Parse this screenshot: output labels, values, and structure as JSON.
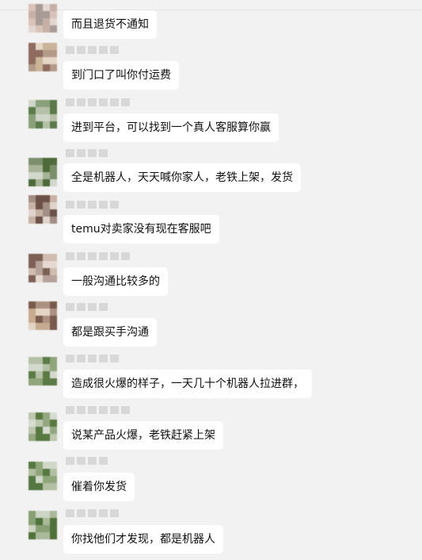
{
  "messages": [
    {
      "text": "而且退货不通知"
    },
    {
      "text": "到门口了叫你付运费"
    },
    {
      "text": "进到平台，可以找到一个真人客服算你赢"
    },
    {
      "text": "全是机器人，天天喊你家人，老铁上架，发货"
    },
    {
      "text": "temu对卖家没有现在客服吧"
    },
    {
      "text": "一般沟通比较多的"
    },
    {
      "text": "都是跟买手沟通"
    },
    {
      "text": "造成很火爆的样子，一天几十个机器人拉进群，"
    },
    {
      "text": "说某产品火爆，老铁赶紧上架"
    },
    {
      "text": "催着你发货"
    },
    {
      "text": "你找他们才发现，都是机器人"
    }
  ],
  "colors": {
    "background": "#f2f2f2",
    "bubble": "#ffffff",
    "text": "#111111"
  },
  "icons": [
    "avatar-pixelated"
  ]
}
